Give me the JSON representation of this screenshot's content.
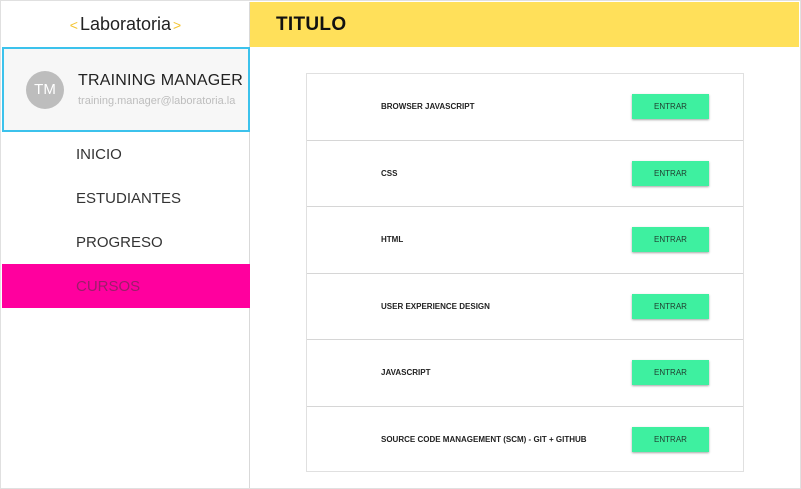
{
  "sidebar": {
    "logo": {
      "left_bracket": "<",
      "text": "Laboratoria",
      "right_bracket": ">"
    },
    "profile": {
      "initials": "TM",
      "name": "TRAINING MANAGER",
      "email": "training.manager@laboratoria.la"
    },
    "nav": [
      {
        "label": "INICIO"
      },
      {
        "label": "ESTUDIANTES"
      },
      {
        "label": "PROGRESO"
      },
      {
        "label": "CURSOS",
        "active": true
      }
    ]
  },
  "header": {
    "title": "TITULO"
  },
  "courses": [
    {
      "name": "BROWSER JAVASCRIPT",
      "button": "ENTRAR"
    },
    {
      "name": "CSS",
      "button": "ENTRAR"
    },
    {
      "name": "HTML",
      "button": "ENTRAR"
    },
    {
      "name": "USER EXPERIENCE DESIGN",
      "button": "ENTRAR"
    },
    {
      "name": "JAVASCRIPT",
      "button": "ENTRAR"
    },
    {
      "name": "SOURCE CODE MANAGEMENT (SCM) - GIT + GITHUB",
      "button": "ENTRAR"
    }
  ],
  "colors": {
    "header_bg": "#ffe05a",
    "active_nav_bg": "#ff009e",
    "button_bg": "#3ef0a0",
    "profile_border": "#3cc2ec"
  }
}
